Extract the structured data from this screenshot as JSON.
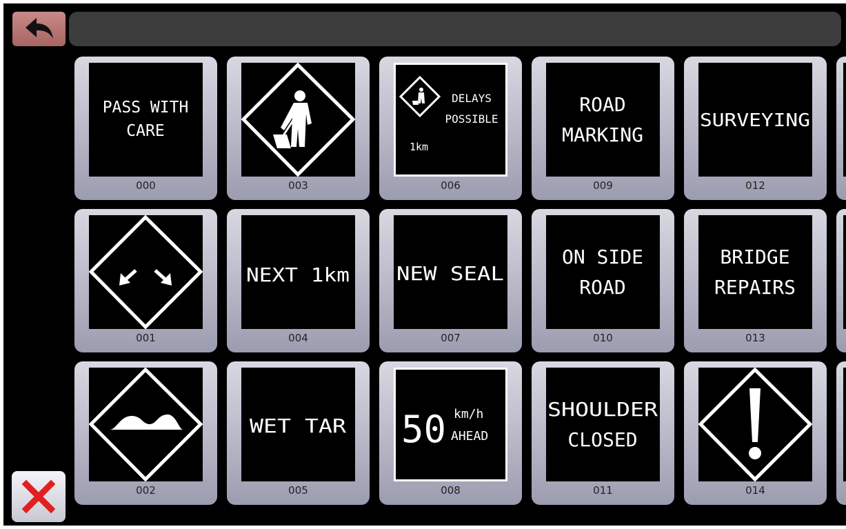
{
  "tiles": [
    {
      "code": "000",
      "text": "PASS WITH",
      "text2": "CARE",
      "kind": "text"
    },
    {
      "code": "003",
      "kind": "worker",
      "icon": "roadwork-worker-icon"
    },
    {
      "code": "006",
      "text": "DELAYS",
      "text2": "POSSIBLE",
      "text3": "1km",
      "kind": "delays"
    },
    {
      "code": "009",
      "text": "ROAD",
      "text2": "MARKING",
      "kind": "text"
    },
    {
      "code": "012",
      "text": "SURVEYING",
      "kind": "text"
    },
    {
      "code": "001",
      "kind": "arrows",
      "icon": "diverging-arrows-icon"
    },
    {
      "code": "004",
      "text": "NEXT 1km",
      "kind": "text"
    },
    {
      "code": "007",
      "text": "NEW SEAL",
      "kind": "text"
    },
    {
      "code": "010",
      "text": "ON SIDE",
      "text2": "ROAD",
      "kind": "text"
    },
    {
      "code": "013",
      "text": "BRIDGE",
      "text2": "REPAIRS",
      "kind": "text"
    },
    {
      "code": "002",
      "kind": "bumps",
      "icon": "road-bumps-icon"
    },
    {
      "code": "005",
      "text": "WET TAR",
      "kind": "text"
    },
    {
      "code": "008",
      "text": "50",
      "text2": "km/h",
      "text3": "AHEAD",
      "kind": "speed"
    },
    {
      "code": "011",
      "text": "SHOULDER",
      "text2": "CLOSED",
      "kind": "text"
    },
    {
      "code": "014",
      "kind": "exclaim",
      "icon": "exclamation-warning-icon"
    }
  ],
  "toolbar": {
    "back_icon": "back-arrow-icon",
    "close_icon": "close-x-icon"
  },
  "colors": {
    "back_button": "#b87674",
    "tile_bg": "#c0c0cc",
    "close_x": "#e02020"
  }
}
